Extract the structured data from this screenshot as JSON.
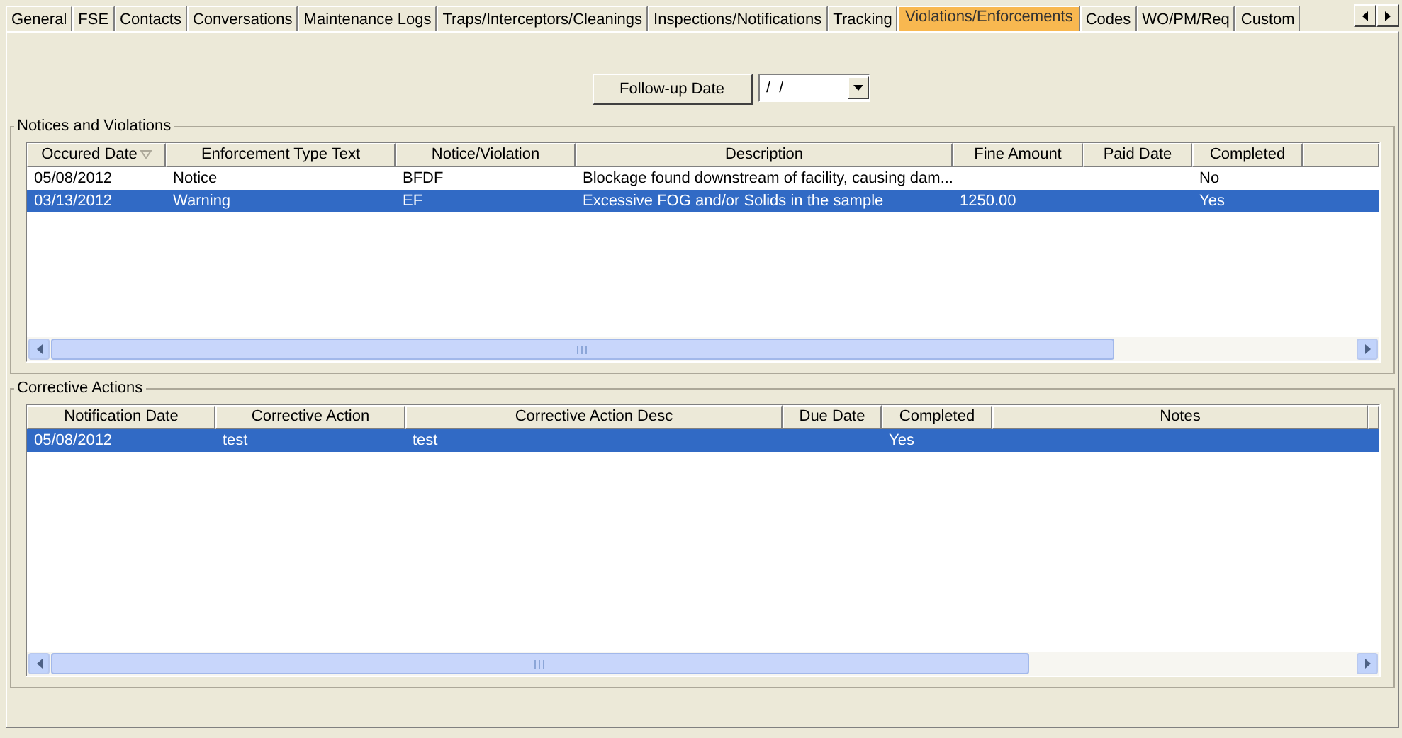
{
  "tabs": [
    {
      "label": "General",
      "selected": false
    },
    {
      "label": "FSE",
      "selected": false
    },
    {
      "label": "Contacts",
      "selected": false
    },
    {
      "label": "Conversations",
      "selected": false
    },
    {
      "label": "Maintenance Logs",
      "selected": false
    },
    {
      "label": "Traps/Interceptors/Cleanings",
      "selected": false
    },
    {
      "label": "Inspections/Notifications",
      "selected": false
    },
    {
      "label": "Tracking",
      "selected": false
    },
    {
      "label": "Violations/Enforcements",
      "selected": true
    },
    {
      "label": "Codes",
      "selected": false
    },
    {
      "label": "WO/PM/Req",
      "selected": false
    },
    {
      "label": "Custom",
      "selected": false
    }
  ],
  "follow_up": {
    "button": "Follow-up Date",
    "date_value": "/  /"
  },
  "notices_and_violations": {
    "title": "Notices and Violations",
    "columns": [
      "Occured Date",
      "Enforcement Type Text",
      "Notice/Violation",
      "Description",
      "Fine Amount",
      "Paid Date",
      "Completed"
    ],
    "rows": [
      {
        "cells": [
          "05/08/2012",
          "Notice",
          "BFDF",
          "Blockage found downstream of facility, causing dam...",
          "",
          "",
          "No"
        ],
        "selected": false
      },
      {
        "cells": [
          "03/13/2012",
          "Warning",
          "EF",
          "Excessive FOG and/or Solids in the sample",
          "1250.00",
          "",
          "Yes"
        ],
        "selected": true
      }
    ]
  },
  "corrective_actions": {
    "title": "Corrective Actions",
    "columns": [
      "Notification Date",
      "Corrective Action",
      "Corrective Action Desc",
      "Due Date",
      "Completed",
      "Notes"
    ],
    "rows": [
      {
        "cells": [
          "05/08/2012",
          "test",
          "test",
          "",
          "Yes",
          ""
        ],
        "selected": true
      }
    ]
  }
}
